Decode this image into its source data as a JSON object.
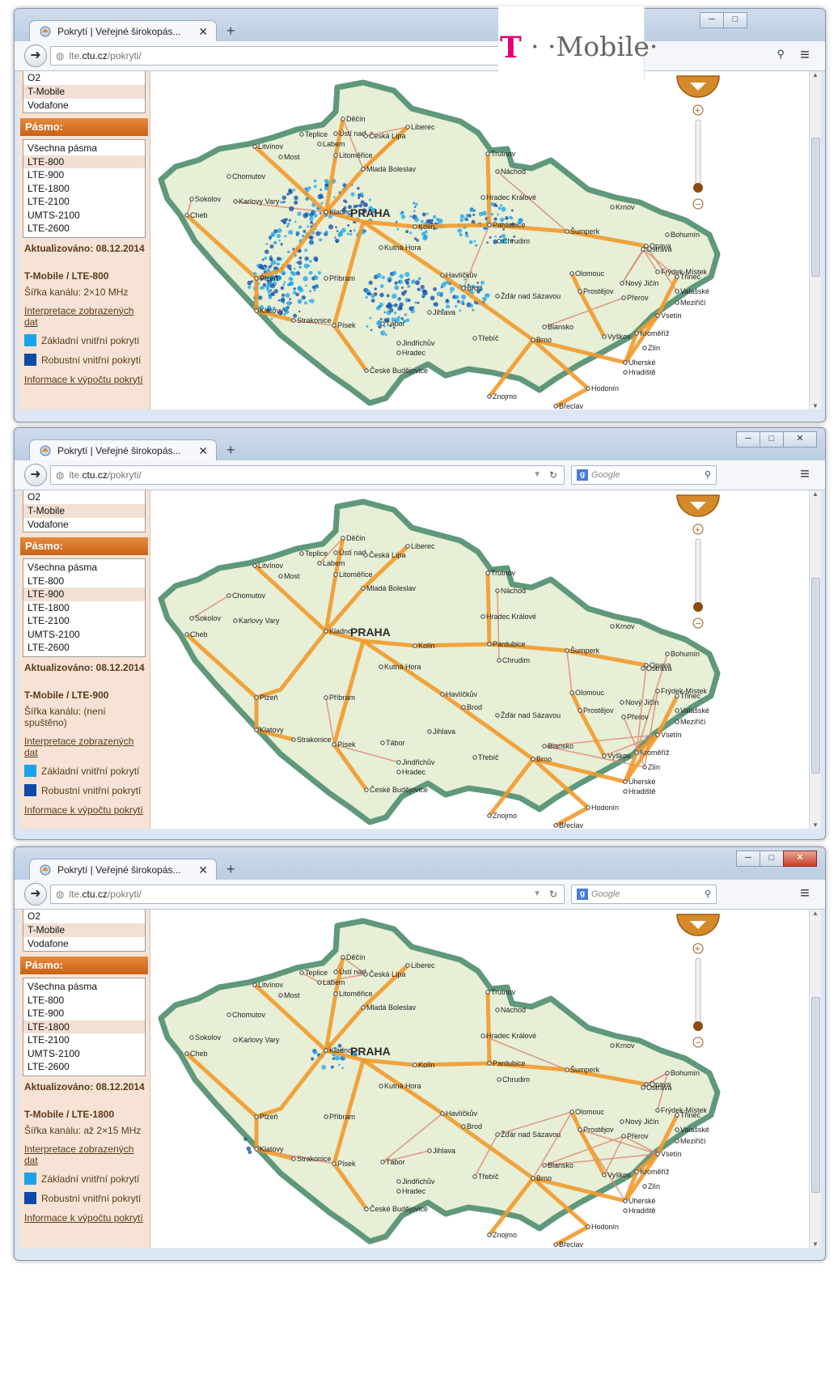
{
  "logo": {
    "t": "T",
    "rest": "· ·Mobile·"
  },
  "browser": {
    "tab_title": "Pokrytí | Veřejné širokopás...",
    "url_prefix": "lte.",
    "url_host": "ctu.cz",
    "url_path": "/pokryti/",
    "search_placeholder": "Google"
  },
  "sidebar": {
    "operators": [
      "O2",
      "T-Mobile",
      "Vodafone"
    ],
    "band_header": "Pásmo:",
    "bands": [
      "Všechna pásma",
      "LTE-800",
      "LTE-900",
      "LTE-1800",
      "LTE-2100",
      "UMTS-2100",
      "LTE-2600"
    ],
    "updated": "Aktualizováno:  08.12.2014",
    "interpretation_link": "Interpretace zobrazených dat",
    "legend_basic": "Základní vnitřní pokrytí",
    "legend_robust": "Robustní vnitřní pokrytí",
    "info_link": "Informace k výpočtu pokrytí"
  },
  "colors": {
    "basic": "#1aa3ec",
    "robust": "#0e4aa8",
    "accent": "#d7702a",
    "map_fill": "#e7efd6",
    "border": "#5f987a"
  },
  "panels": [
    {
      "selected_band": "LTE-800",
      "op_band": "T-Mobile / LTE-800",
      "channel": "Šířka kanálu: 2×10 MHz",
      "coverage": "wide"
    },
    {
      "selected_band": "LTE-900",
      "op_band": "T-Mobile / LTE-900",
      "channel": "Šířka kanálu: (není spuštěno)",
      "coverage": "none"
    },
    {
      "selected_band": "LTE-1800",
      "op_band": "T-Mobile / LTE-1800",
      "channel": "Šířka kanálu: až 2×15 MHz",
      "coverage": "prague"
    }
  ],
  "map": {
    "capital": "PRAHA",
    "cities": [
      "Děčín",
      "Liberec",
      "Teplice",
      "Ústí nad",
      "Česká Lípa",
      "Litvínov",
      "Labem",
      "Most",
      "Litoměřice",
      "Mladá Boleslav",
      "Trutnov",
      "Chomutov",
      "Náchod",
      "Sokolov",
      "Karlovy Vary",
      "Kladno",
      "Hradec Králové",
      "Cheb",
      "Kolín",
      "Pardubice",
      "Chrudim",
      "Kutná Hora",
      "Krnov",
      "Šumperk",
      "Opava",
      "Bohumín",
      "Ostrava",
      "Plzeň",
      "Příbram",
      "Frýdek-Místek",
      "Třinec",
      "Havlíčkův",
      "Brod",
      "Žďár nad Sázavou",
      "Olomouc",
      "Nový Jičín",
      "Valašské",
      "Meziříčí",
      "Prostějov",
      "Přerov",
      "Klatovy",
      "Strakonice",
      "Písek",
      "Tábor",
      "Jihlava",
      "Blansko",
      "Vsetín",
      "Kroměříž",
      "Vyškov",
      "Zlín",
      "Jindřichův",
      "Hradec",
      "Třebíč",
      "Brno",
      "Uherské",
      "Hradiště",
      "České Budějovice",
      "Hodonín",
      "Znojmo",
      "Břeclav"
    ]
  }
}
